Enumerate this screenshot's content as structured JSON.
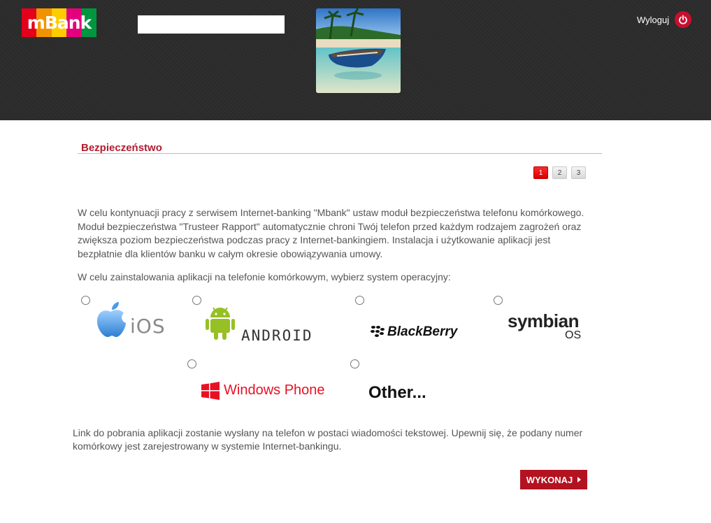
{
  "header": {
    "logo_text": "mBank",
    "logo_colors": [
      "#e3001b",
      "#f39200",
      "#ffcc00",
      "#e4007c",
      "#009640"
    ],
    "search_value": "",
    "logout_label": "Wyloguj"
  },
  "section": {
    "title": "Bezpieczeństwo",
    "pages": [
      "1",
      "2",
      "3"
    ],
    "current_page": "1"
  },
  "intro_text": "W celu kontynuacji pracy z serwisem Internet-banking \"Mbank\" ustaw moduł bezpieczeństwa telefonu komórkowego. Moduł bezpieczeństwa \"Trusteer Rapport\" automatycznie chroni Twój telefon przed każdym rodzajem zagrożeń oraz zwiększa poziom bezpieczeństwa podczas pracy z Internet-bankingiem. Instalacja i użytkowanie aplikacji jest bezpłatnie dla klientów banku w całym okresie obowiązywania umowy.",
  "choose_text": "W celu zainstalowania aplikacji na telefonie komórkowym, wybierz system operacyjny:",
  "os_options": {
    "ios": "iOS",
    "android": "ANDROID",
    "blackberry": "BlackBerry",
    "symbian": "symbian",
    "symbian_sub": "OS",
    "windows_phone": "Windows Phone",
    "other": "Other..."
  },
  "footer_text": "Link do pobrania aplikacji zostanie wysłany na telefon w postaci wiadomości tekstowej. Upewnij się, że podany numer komórkowy jest zarejestrowany w systemie Internet-bankingu.",
  "submit_label": "WYKONAJ",
  "colors": {
    "accent": "#b31b2f",
    "header_bg": "#2b2b2b",
    "android_green": "#97c024",
    "windows_red": "#e81123"
  }
}
